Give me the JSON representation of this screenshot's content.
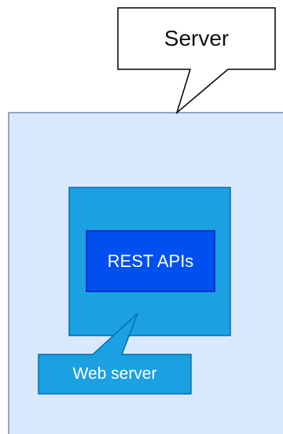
{
  "labels": {
    "server": "Server",
    "rest_apis": "REST APIs",
    "web_server": "Web server"
  },
  "colors": {
    "server_fill": "#dae8fc",
    "server_stroke": "#6c8ebf",
    "web_server_fill": "#1ba1e2",
    "web_server_stroke": "#006eaf",
    "rest_fill": "#0050ef",
    "rest_stroke": "#001dbc",
    "callout_fill": "#ffffff",
    "callout_stroke": "#000000"
  }
}
